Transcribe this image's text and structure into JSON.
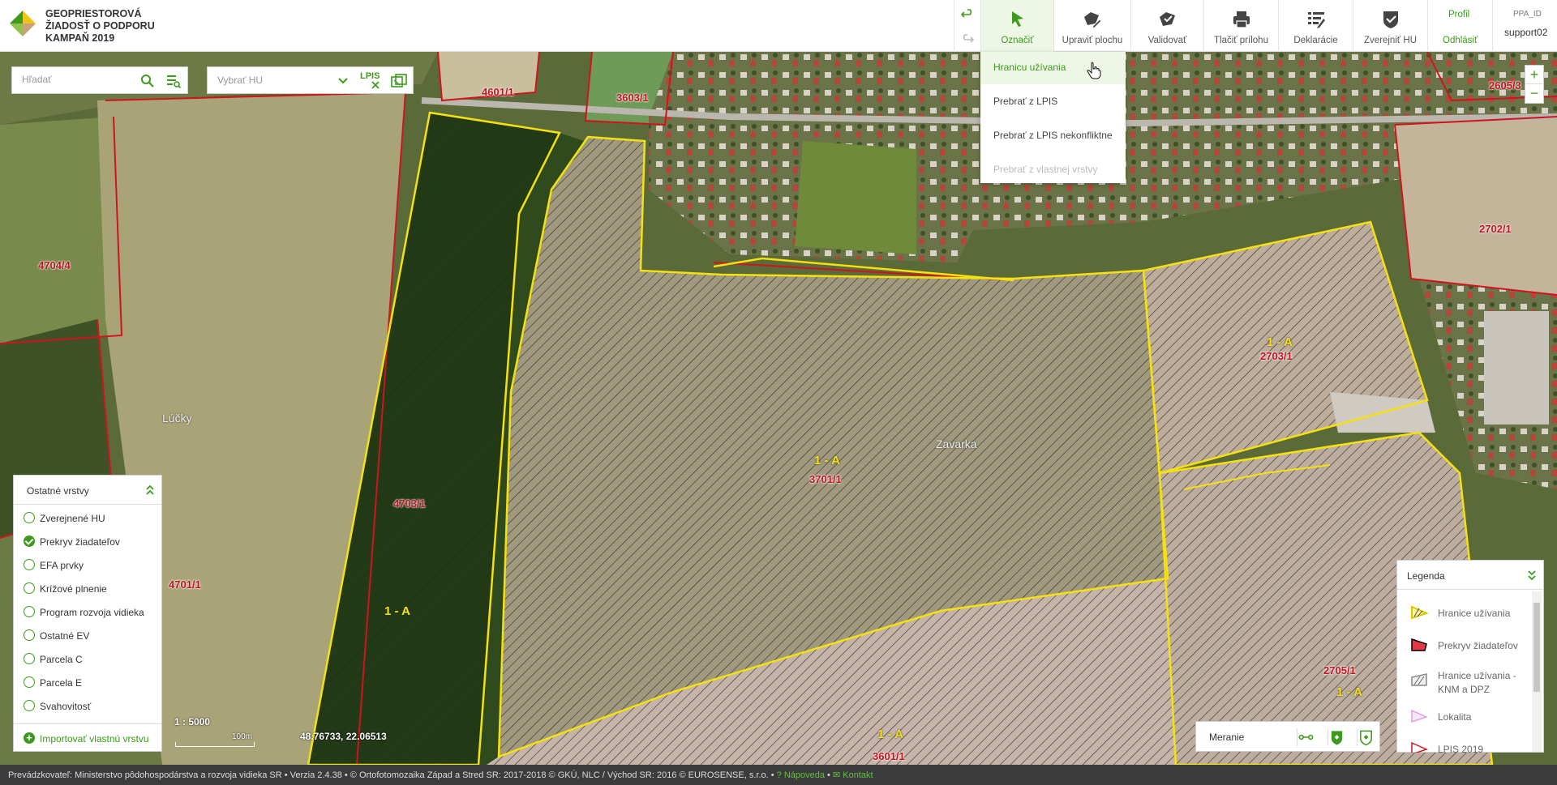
{
  "app": {
    "title_lines": [
      "GEOPRIESTOROVÁ",
      "ŽIADOSŤ O PODPORU",
      "KAMPAŇ 2019"
    ]
  },
  "toolbar": {
    "buttons": [
      {
        "label": "Označiť",
        "icon": "cursor-arrow-icon",
        "active": true
      },
      {
        "label": "Upraviť plochu",
        "icon": "edit-area-icon"
      },
      {
        "label": "Validovať",
        "icon": "validate-icon"
      },
      {
        "label": "Tlačiť prílohu",
        "icon": "printer-icon"
      },
      {
        "label": "Deklarácie",
        "icon": "declaration-icon"
      },
      {
        "label": "Zverejniť HU",
        "icon": "publish-shield-icon"
      }
    ],
    "profile": "Profil",
    "logout": "Odhlásiť",
    "user_id_label": "PPA_ID",
    "username": "support02"
  },
  "dropdown": {
    "items": [
      {
        "label": "Hranicu užívania",
        "state": "active"
      },
      {
        "label": "Prebrať z LPIS",
        "state": "normal"
      },
      {
        "label": "Prebrať z LPIS nekonfliktne",
        "state": "normal"
      },
      {
        "label": "Prebrať z vlastnej vrstvy",
        "state": "disabled"
      }
    ]
  },
  "search": {
    "placeholder": "Hľadať"
  },
  "hu_select": {
    "placeholder": "Vybrať HU",
    "lpis_label": "LPIS"
  },
  "map": {
    "parcel_labels": [
      "4601/1",
      "3603/1",
      "2605/3",
      "4704/4",
      "2702/1",
      "2703/1",
      "3701/1",
      "4703/1",
      "4701/1",
      "2705/1",
      "3601/1"
    ],
    "block_labels": [
      "1 - A",
      "1 - A",
      "1 - A",
      "1 - A",
      "1 - A"
    ],
    "place_names": [
      "Lúčky",
      "Zavarka"
    ]
  },
  "layers": {
    "title": "Ostatné vrstvy",
    "items": [
      {
        "label": "Zverejnené HU",
        "checked": false
      },
      {
        "label": "Prekryv žiadateľov",
        "checked": true
      },
      {
        "label": "EFA prvky",
        "checked": false
      },
      {
        "label": "Krížové plnenie",
        "checked": false
      },
      {
        "label": "Program rozvoja vidieka",
        "checked": false
      },
      {
        "label": "Ostatné EV",
        "checked": false
      },
      {
        "label": "Parcela C",
        "checked": false
      },
      {
        "label": "Parcela E",
        "checked": false
      },
      {
        "label": "Svahovitosť",
        "checked": false
      }
    ],
    "import_label": "Importovať vlastnú vrstvu"
  },
  "scale": {
    "ratio": "1 : 5000",
    "bar_label": "100m",
    "coordinates": "48.76733, 22.06513"
  },
  "measure": {
    "label": "Meranie"
  },
  "legend": {
    "title": "Legenda",
    "items": [
      {
        "label": "Hranice užívania"
      },
      {
        "label": "Prekryv žiadateľov"
      },
      {
        "label": "Hranice užívania - KNM a DPZ"
      },
      {
        "label": "Lokalita"
      },
      {
        "label": "LPIS 2019"
      }
    ]
  },
  "footer": {
    "text": "Prevádzkovateľ: Ministerstvo pôdohospodárstva a rozvoja vidieka SR • Verzia 2.4.38 • © Ortofotomozaika Západ a Stred SR: 2017-2018 © GKÚ, NLC / Východ SR: 2016 © EUROSENSE, s.r.o. •",
    "help": "Nápoveda",
    "contact": "Kontakt"
  },
  "colors": {
    "accent": "#3e9a1c",
    "parcel_border": "#c4121e",
    "usage_border": "#f5e10f"
  }
}
